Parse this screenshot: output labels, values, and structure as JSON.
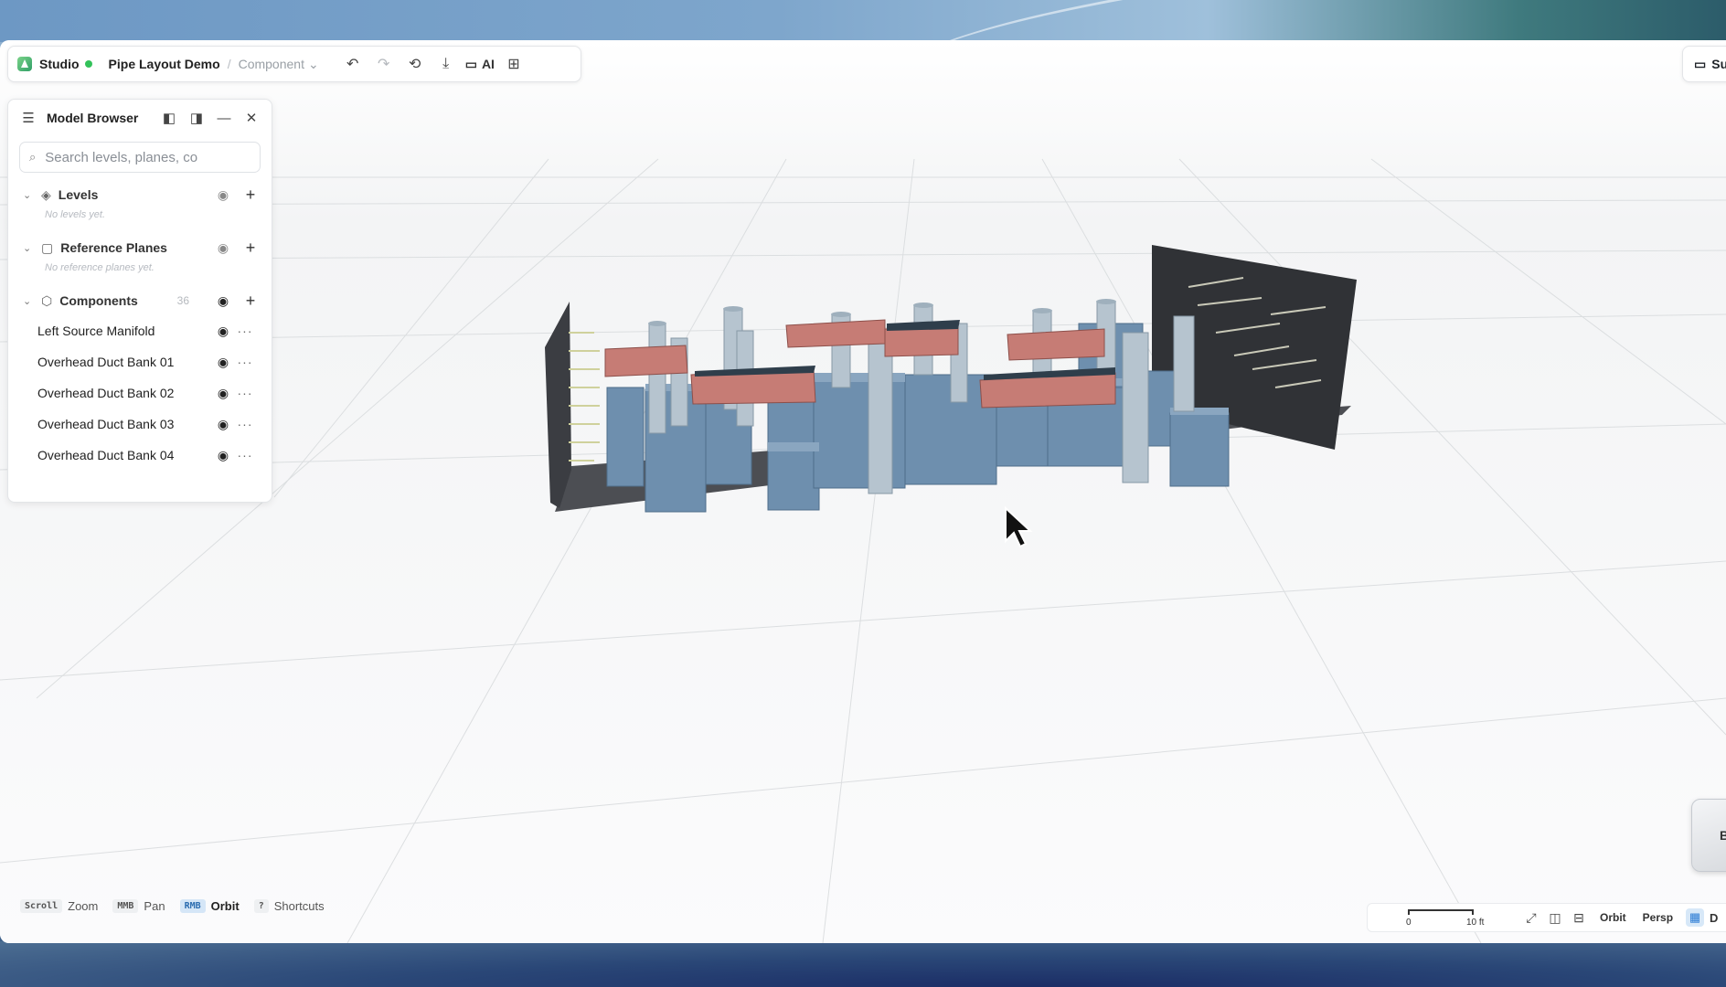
{
  "toolbar": {
    "app_name": "Studio",
    "project_name": "Pipe Layout Demo",
    "separator": "/",
    "mode": "Component",
    "ai_label": "AI"
  },
  "right_pill": {
    "label": "Su"
  },
  "model_browser": {
    "title": "Model Browser",
    "search_placeholder": "Search levels, planes, co",
    "sections": {
      "levels": {
        "label": "Levels",
        "empty": "No levels yet."
      },
      "reference_planes": {
        "label": "Reference Planes",
        "empty": "No reference planes yet."
      },
      "components": {
        "label": "Components",
        "count": "36"
      }
    },
    "components": [
      "Left Source Manifold",
      "Overhead Duct Bank 01",
      "Overhead Duct Bank 02",
      "Overhead Duct Bank 03",
      "Overhead Duct Bank 04"
    ]
  },
  "bottom_hints": [
    {
      "key": "Scroll",
      "action": "Zoom",
      "active": false
    },
    {
      "key": "MMB",
      "action": "Pan",
      "active": false
    },
    {
      "key": "RMB",
      "action": "Orbit",
      "active": true
    },
    {
      "key": "?",
      "action": "Shortcuts",
      "active": false
    }
  ],
  "scale": {
    "start": "0",
    "end": "10 ft"
  },
  "view_controls": {
    "orbit": "Orbit",
    "projection": "Persp",
    "extra": "D"
  },
  "nav_cube": {
    "face": "B"
  },
  "colors": {
    "status_green": "#33c25a",
    "duct_red": "#c97a74",
    "equipment_blue": "#6d8fae",
    "floor_dark": "#4d4f54",
    "accent_blue": "#2a7bd4"
  }
}
